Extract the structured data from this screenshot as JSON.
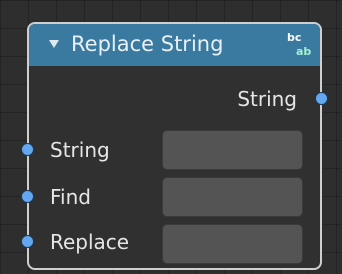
{
  "node": {
    "title": "Replace String",
    "header_icon": "string-icon",
    "header_color": "#3a7aa0",
    "socket_color": "#63a7f0",
    "output": {
      "label": "String"
    },
    "inputs": [
      {
        "label": "String",
        "value": ""
      },
      {
        "label": "Find",
        "value": ""
      },
      {
        "label": "Replace",
        "value": ""
      }
    ]
  }
}
